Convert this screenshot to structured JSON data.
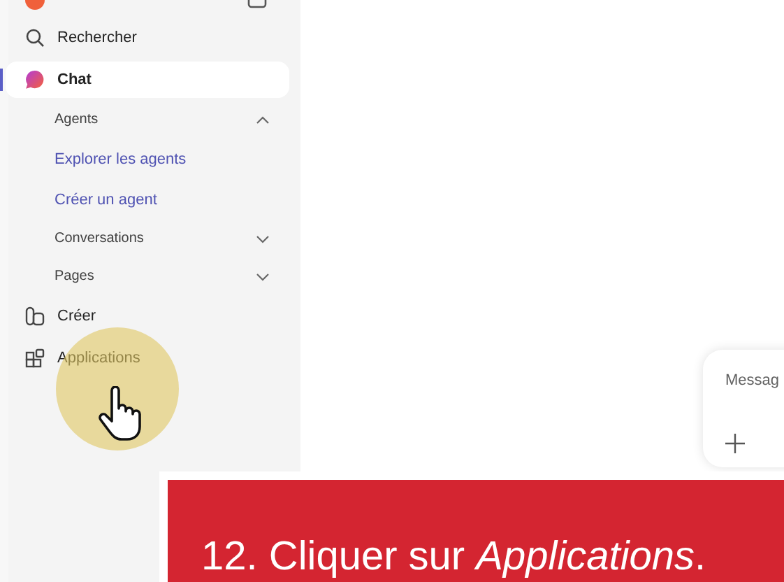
{
  "sidebar": {
    "items": [
      {
        "kind": "search",
        "label": "Rechercher",
        "selected": false
      },
      {
        "kind": "chat",
        "label": "Chat",
        "selected": true
      },
      {
        "kind": "section",
        "label": "Agents",
        "expanded": true,
        "children": [
          {
            "label": "Explorer les agents"
          },
          {
            "label": "Créer un agent"
          }
        ]
      },
      {
        "kind": "section",
        "label": "Conversations",
        "expanded": false
      },
      {
        "kind": "section",
        "label": "Pages",
        "expanded": false
      },
      {
        "kind": "create",
        "label": "Créer",
        "selected": false
      },
      {
        "kind": "apps",
        "label": "Applications",
        "selected": false
      }
    ]
  },
  "composer": {
    "placeholder": "Messag"
  },
  "callout": {
    "text": "12. Cliquer sur *Applications*."
  }
}
